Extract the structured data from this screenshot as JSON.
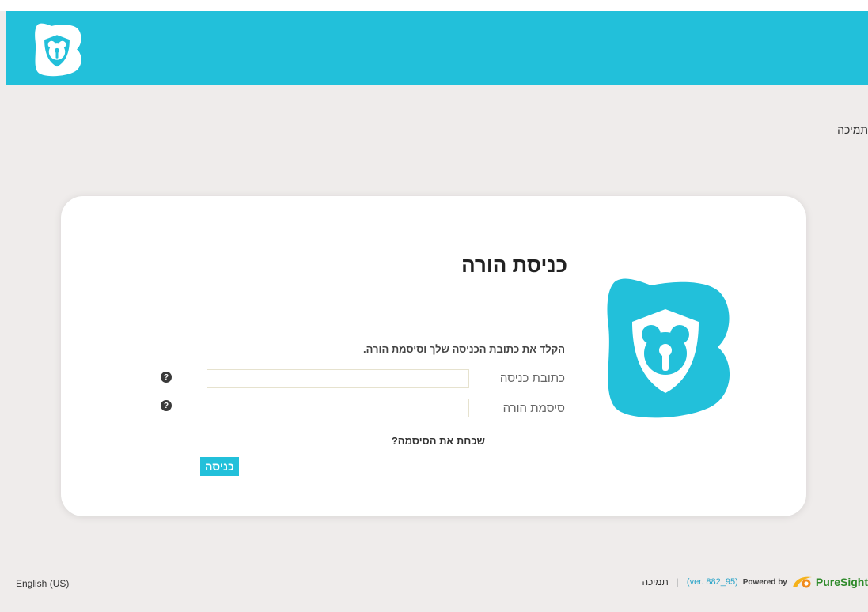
{
  "header": {
    "logo_icon": "bear-shield-logo-icon",
    "brand_color": "#22c0da"
  },
  "top_nav": {
    "support_label": "תמיכה"
  },
  "login": {
    "title": "כניסת הורה",
    "instruction": "הקלד את כתובת הכניסה שלך וסיסמת הורה.",
    "email_label": "כתובת כניסה",
    "email_value": "",
    "password_label": "סיסמת הורה",
    "password_value": "",
    "help_glyph": "?",
    "forgot_label": "שכחת את הסיסמה?",
    "submit_label": "כניסה"
  },
  "footer": {
    "language_label": "English (US)",
    "support_label": "תמיכה",
    "separator": "|",
    "version_label": "(ver. 882_95)",
    "powered_by_label": "Powered by",
    "brand_label": "PureSight"
  }
}
